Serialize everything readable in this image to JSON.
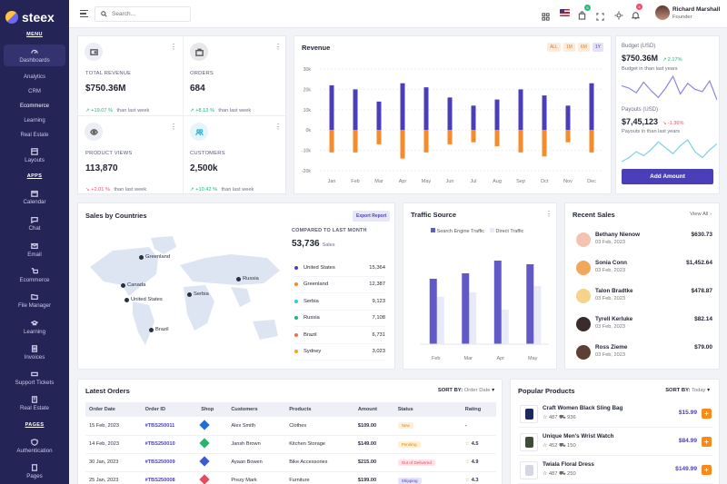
{
  "brand": {
    "name": "steex"
  },
  "sidebar": {
    "menu_title": "MENU",
    "dashboards": "Dashboards",
    "analytics": "Analytics",
    "crm": "CRM",
    "ecommerce_sub": "Ecommerce",
    "learning_sub": "Learning",
    "real_estate_sub": "Real Estate",
    "layouts": "Layouts",
    "apps_title": "APPS",
    "calendar": "Calendar",
    "chat": "Chat",
    "email": "Email",
    "ecommerce": "Ecommerce",
    "file_manager": "File Manager",
    "learning": "Learning",
    "invoices": "Invoices",
    "support": "Support Tickets",
    "real_estate": "Real Estate",
    "pages_title": "PAGES",
    "authentication": "Authentication",
    "pages": "Pages"
  },
  "topbar": {
    "search_placeholder": "Search...",
    "notif_count": "4",
    "user_name": "Richard Marshall",
    "user_role": "Founder"
  },
  "stats": {
    "revenue": {
      "label": "TOTAL REVENUE",
      "value": "$750.36M",
      "delta": "+19.07 %",
      "suffix": "than last week"
    },
    "orders": {
      "label": "ORDERS",
      "value": "684",
      "delta": "+8.13 %",
      "suffix": "than last week"
    },
    "views": {
      "label": "PRODUCT VIEWS",
      "value": "113,870",
      "delta": "+2.01 %",
      "suffix": "than last week"
    },
    "customers": {
      "label": "CUSTOMERS",
      "value": "2,500k",
      "delta": "+10.42 %",
      "suffix": "than last week"
    }
  },
  "revenue_chart": {
    "title": "Revenue",
    "filters": [
      "ALL",
      "1M",
      "6M",
      "1Y"
    ],
    "active_filter": "1Y"
  },
  "chart_data": [
    {
      "type": "bar",
      "title": "Revenue",
      "categories": [
        "Jan",
        "Feb",
        "Mar",
        "Apr",
        "May",
        "Jun",
        "Jul",
        "Aug",
        "Sep",
        "Oct",
        "Nov",
        "Dec"
      ],
      "yticks": [
        "30k",
        "20k",
        "10k",
        "0k",
        "-10k",
        "-20k"
      ],
      "ylim": [
        -20,
        30
      ],
      "series": [
        {
          "values": [
            22,
            20,
            14,
            23,
            21,
            16,
            12,
            15,
            20,
            17,
            12,
            23
          ],
          "color": "#4b3fb8"
        },
        {
          "values": [
            -11,
            -11,
            -7,
            -14,
            -11,
            -7,
            -6,
            -8,
            -11,
            -13,
            -6,
            -11
          ],
          "color": "#f58b2a"
        }
      ]
    },
    {
      "type": "bar",
      "title": "Traffic Source",
      "categories": [
        "Feb",
        "Mar",
        "Apr",
        "May"
      ],
      "series": [
        {
          "name": "Search Engine Traffic",
          "values": [
            72,
            78,
            92,
            88
          ],
          "color": "#6259c9"
        },
        {
          "name": "Direct Traffic",
          "values": [
            52,
            57,
            38,
            64
          ],
          "color": "#e9eaf8"
        }
      ]
    },
    {
      "type": "line",
      "title": "Budget (USD)",
      "values": [
        62,
        60,
        56,
        65,
        58,
        52,
        60,
        70,
        55,
        64,
        59,
        57,
        66,
        50
      ],
      "color": "#8a85e8"
    },
    {
      "type": "line",
      "title": "Payouts (USD)",
      "values": [
        30,
        34,
        40,
        36,
        42,
        50,
        44,
        38,
        46,
        52,
        40,
        34,
        42,
        48
      ],
      "color": "#7fd0e8"
    }
  ],
  "budget": {
    "label": "Budget (USD)",
    "value": "$750.36M",
    "delta": "2.17%",
    "note": "Budget in than last years"
  },
  "payouts": {
    "label": "Payouts (USD)",
    "value": "$7,45,123",
    "delta": "-1.36%",
    "note": "Payouts in than last years"
  },
  "add_amount": "Add Amount",
  "countries": {
    "title": "Sales by Countries",
    "export": "Export Report",
    "compared": "COMPARED TO LAST MONTH",
    "total": "53,736",
    "total_suffix": "Sales",
    "list": [
      {
        "name": "United States",
        "value": "15,364",
        "color": "#4b3fb8"
      },
      {
        "name": "Greenland",
        "value": "12,387",
        "color": "#f58b2a"
      },
      {
        "name": "Serbia",
        "value": "9,123",
        "color": "#38c6e8"
      },
      {
        "name": "Russia",
        "value": "7,108",
        "color": "#20b27a"
      },
      {
        "name": "Brazil",
        "value": "6,731",
        "color": "#f06c5a"
      },
      {
        "name": "Sydney",
        "value": "3,023",
        "color": "#f5a623"
      }
    ],
    "map_labels": [
      "Greenland",
      "Canada",
      "United States",
      "Serbia",
      "Russia",
      "Brazil"
    ]
  },
  "traffic": {
    "title": "Traffic Source",
    "legend1": "Search Engine Traffic",
    "legend2": "Direct Traffic"
  },
  "recent_sales": {
    "title": "Recent Sales",
    "view_all": "View All",
    "items": [
      {
        "name": "Bethany Nienow",
        "date": "03 Feb, 2023",
        "amount": "$630.73"
      },
      {
        "name": "Sonia Conn",
        "date": "03 Feb, 2023",
        "amount": "$1,452.64"
      },
      {
        "name": "Talon Bradtke",
        "date": "03 Feb, 2023",
        "amount": "$478.87"
      },
      {
        "name": "Tyrell Kerluke",
        "date": "03 Feb, 2023",
        "amount": "$82.14"
      },
      {
        "name": "Ross Zieme",
        "date": "03 Feb, 2023",
        "amount": "$79.00"
      }
    ]
  },
  "orders": {
    "title": "Latest Orders",
    "sort_label": "SORT BY:",
    "sort_value": "Order Date",
    "headers": [
      "Order Date",
      "Order ID",
      "Shop",
      "Customers",
      "Products",
      "Amount",
      "Status",
      "Rating"
    ],
    "rows": [
      {
        "date": "15 Feb, 2023",
        "id": "#TBS250011",
        "customer": "Alex Smith",
        "product": "Clothes",
        "amount": "$109.00",
        "status": "New",
        "rating": "-"
      },
      {
        "date": "14 Feb, 2023",
        "id": "#TBS250010",
        "customer": "Jansh Brown",
        "product": "Kitchen Storage",
        "amount": "$149.00",
        "status": "Pending",
        "rating": "4.5"
      },
      {
        "date": "30 Jan, 2023",
        "id": "#TBS250009",
        "customer": "Ayaan Bowen",
        "product": "Bike Accessories",
        "amount": "$215.00",
        "status": "Out of Delivered",
        "rating": "4.9"
      },
      {
        "date": "25 Jan, 2023",
        "id": "#TBS250008",
        "customer": "Prezy Mark",
        "product": "Furniture",
        "amount": "$199.00",
        "status": "Shipping",
        "rating": "4.3"
      }
    ]
  },
  "popular": {
    "title": "Popular Products",
    "sort_label": "SORT BY:",
    "sort_value": "Today",
    "items": [
      {
        "name": "Craft Women Black Sling Bag",
        "rating": "487",
        "sold": "936",
        "price": "$15.99"
      },
      {
        "name": "Unique Men's Wrist Watch",
        "rating": "452",
        "sold": "150",
        "price": "$84.99"
      },
      {
        "name": "Twiala Floral Dress",
        "rating": "487",
        "sold": "250",
        "price": "$149.99"
      }
    ]
  }
}
